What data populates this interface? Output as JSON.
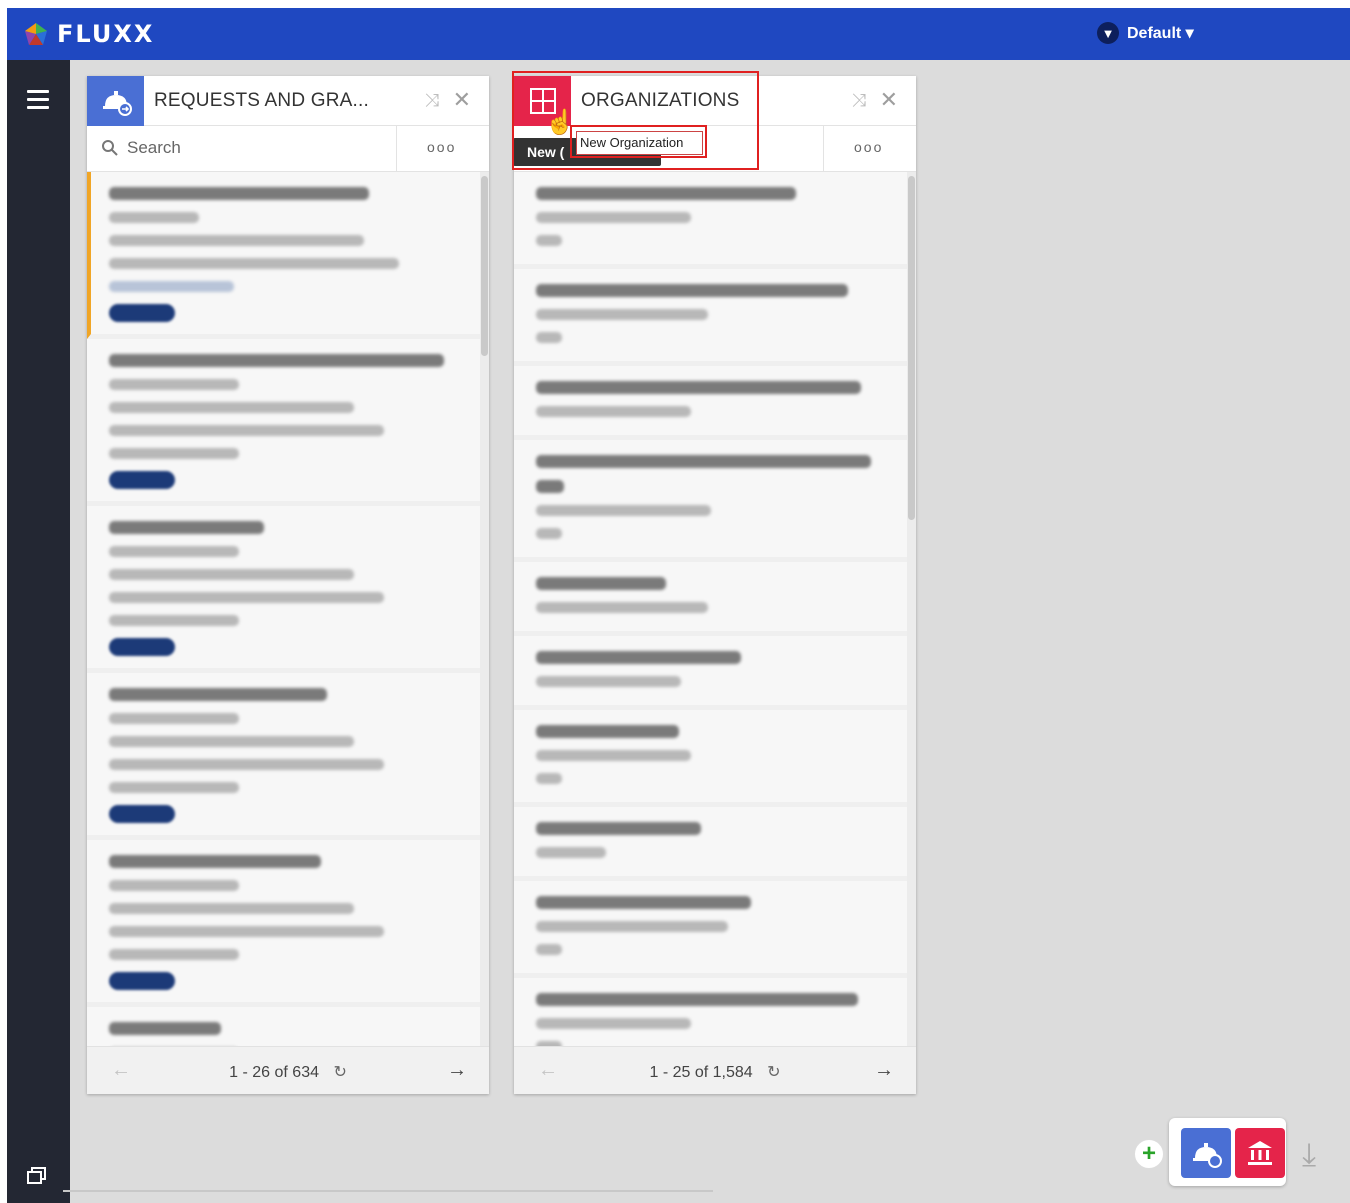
{
  "app": {
    "name": "FLUXX"
  },
  "topbar": {
    "filter_label": "Default ▾",
    "filter_icon": "funnel-icon"
  },
  "sidebar": {
    "menu_icon": "hamburger-icon",
    "bottom_icon": "cards-icon"
  },
  "cards": [
    {
      "title": "REQUESTS AND GRA...",
      "search_placeholder": "Search",
      "more_label": "ooo",
      "pager": "1 - 26 of 634",
      "icon": "requests-icon",
      "colors": {
        "icon_bg": "#4a6fd4"
      }
    },
    {
      "title": "ORGANIZATIONS",
      "more_label": "ooo",
      "pager": "1 - 25 of 1,584",
      "icon": "new-organization-icon",
      "colors": {
        "icon_bg": "#e5244a"
      }
    }
  ],
  "tooltip": {
    "dark_text": "New (",
    "light_text": "New Organization"
  },
  "dock": {
    "add_label": "+"
  },
  "colors": {
    "topbar": "#1f48c1",
    "sidebar": "#232733",
    "accent_orange": "#f0a526",
    "pill": "#1c3a78"
  }
}
